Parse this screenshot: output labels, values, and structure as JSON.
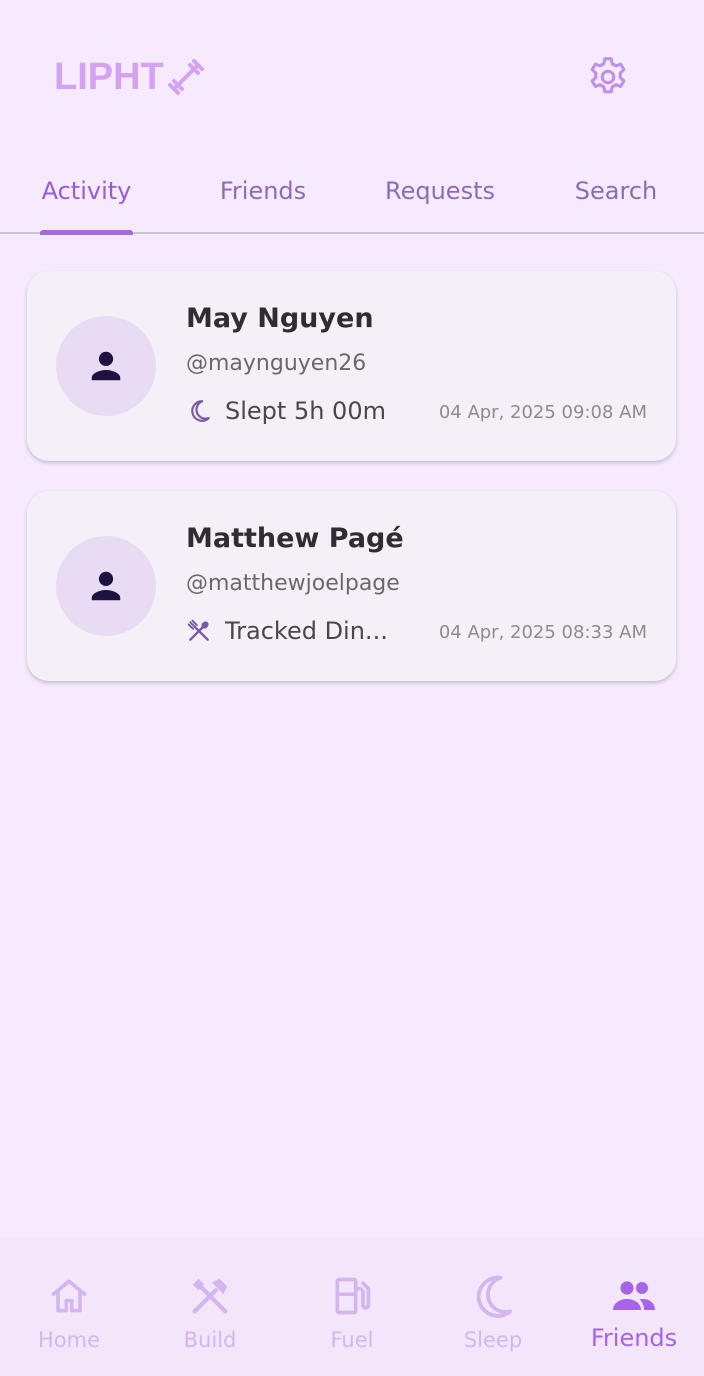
{
  "header": {
    "logo_text": "LIPHT",
    "logo_icon": "dumbbell-icon",
    "settings_icon": "gear-icon"
  },
  "tabs": [
    {
      "label": "Activity",
      "active": true
    },
    {
      "label": "Friends",
      "active": false
    },
    {
      "label": "Requests",
      "active": false
    },
    {
      "label": "Search",
      "active": false
    }
  ],
  "activity_feed": [
    {
      "name": "May Nguyen",
      "handle": "@maynguyen26",
      "activity_icon": "moon-icon",
      "activity_text": "Slept 5h 00m",
      "time": "04 Apr, 2025 09:08 AM"
    },
    {
      "name": "Matthew Pagé",
      "handle": "@matthewjoelpage",
      "activity_icon": "fork-spoon-icon",
      "activity_text": "Tracked Din...",
      "time": "04 Apr, 2025 08:33 AM"
    }
  ],
  "bottom_nav": [
    {
      "label": "Home",
      "icon": "home-icon",
      "active": false
    },
    {
      "label": "Build",
      "icon": "tools-icon",
      "active": false
    },
    {
      "label": "Fuel",
      "icon": "fuel-pump-icon",
      "active": false
    },
    {
      "label": "Sleep",
      "icon": "moon-icon",
      "active": false
    },
    {
      "label": "Friends",
      "icon": "people-icon",
      "active": true
    }
  ],
  "colors": {
    "background": "#f6ebfe",
    "accent": "#a26be0",
    "logo": "#d3a2f2",
    "card": "#f5f0f8"
  }
}
